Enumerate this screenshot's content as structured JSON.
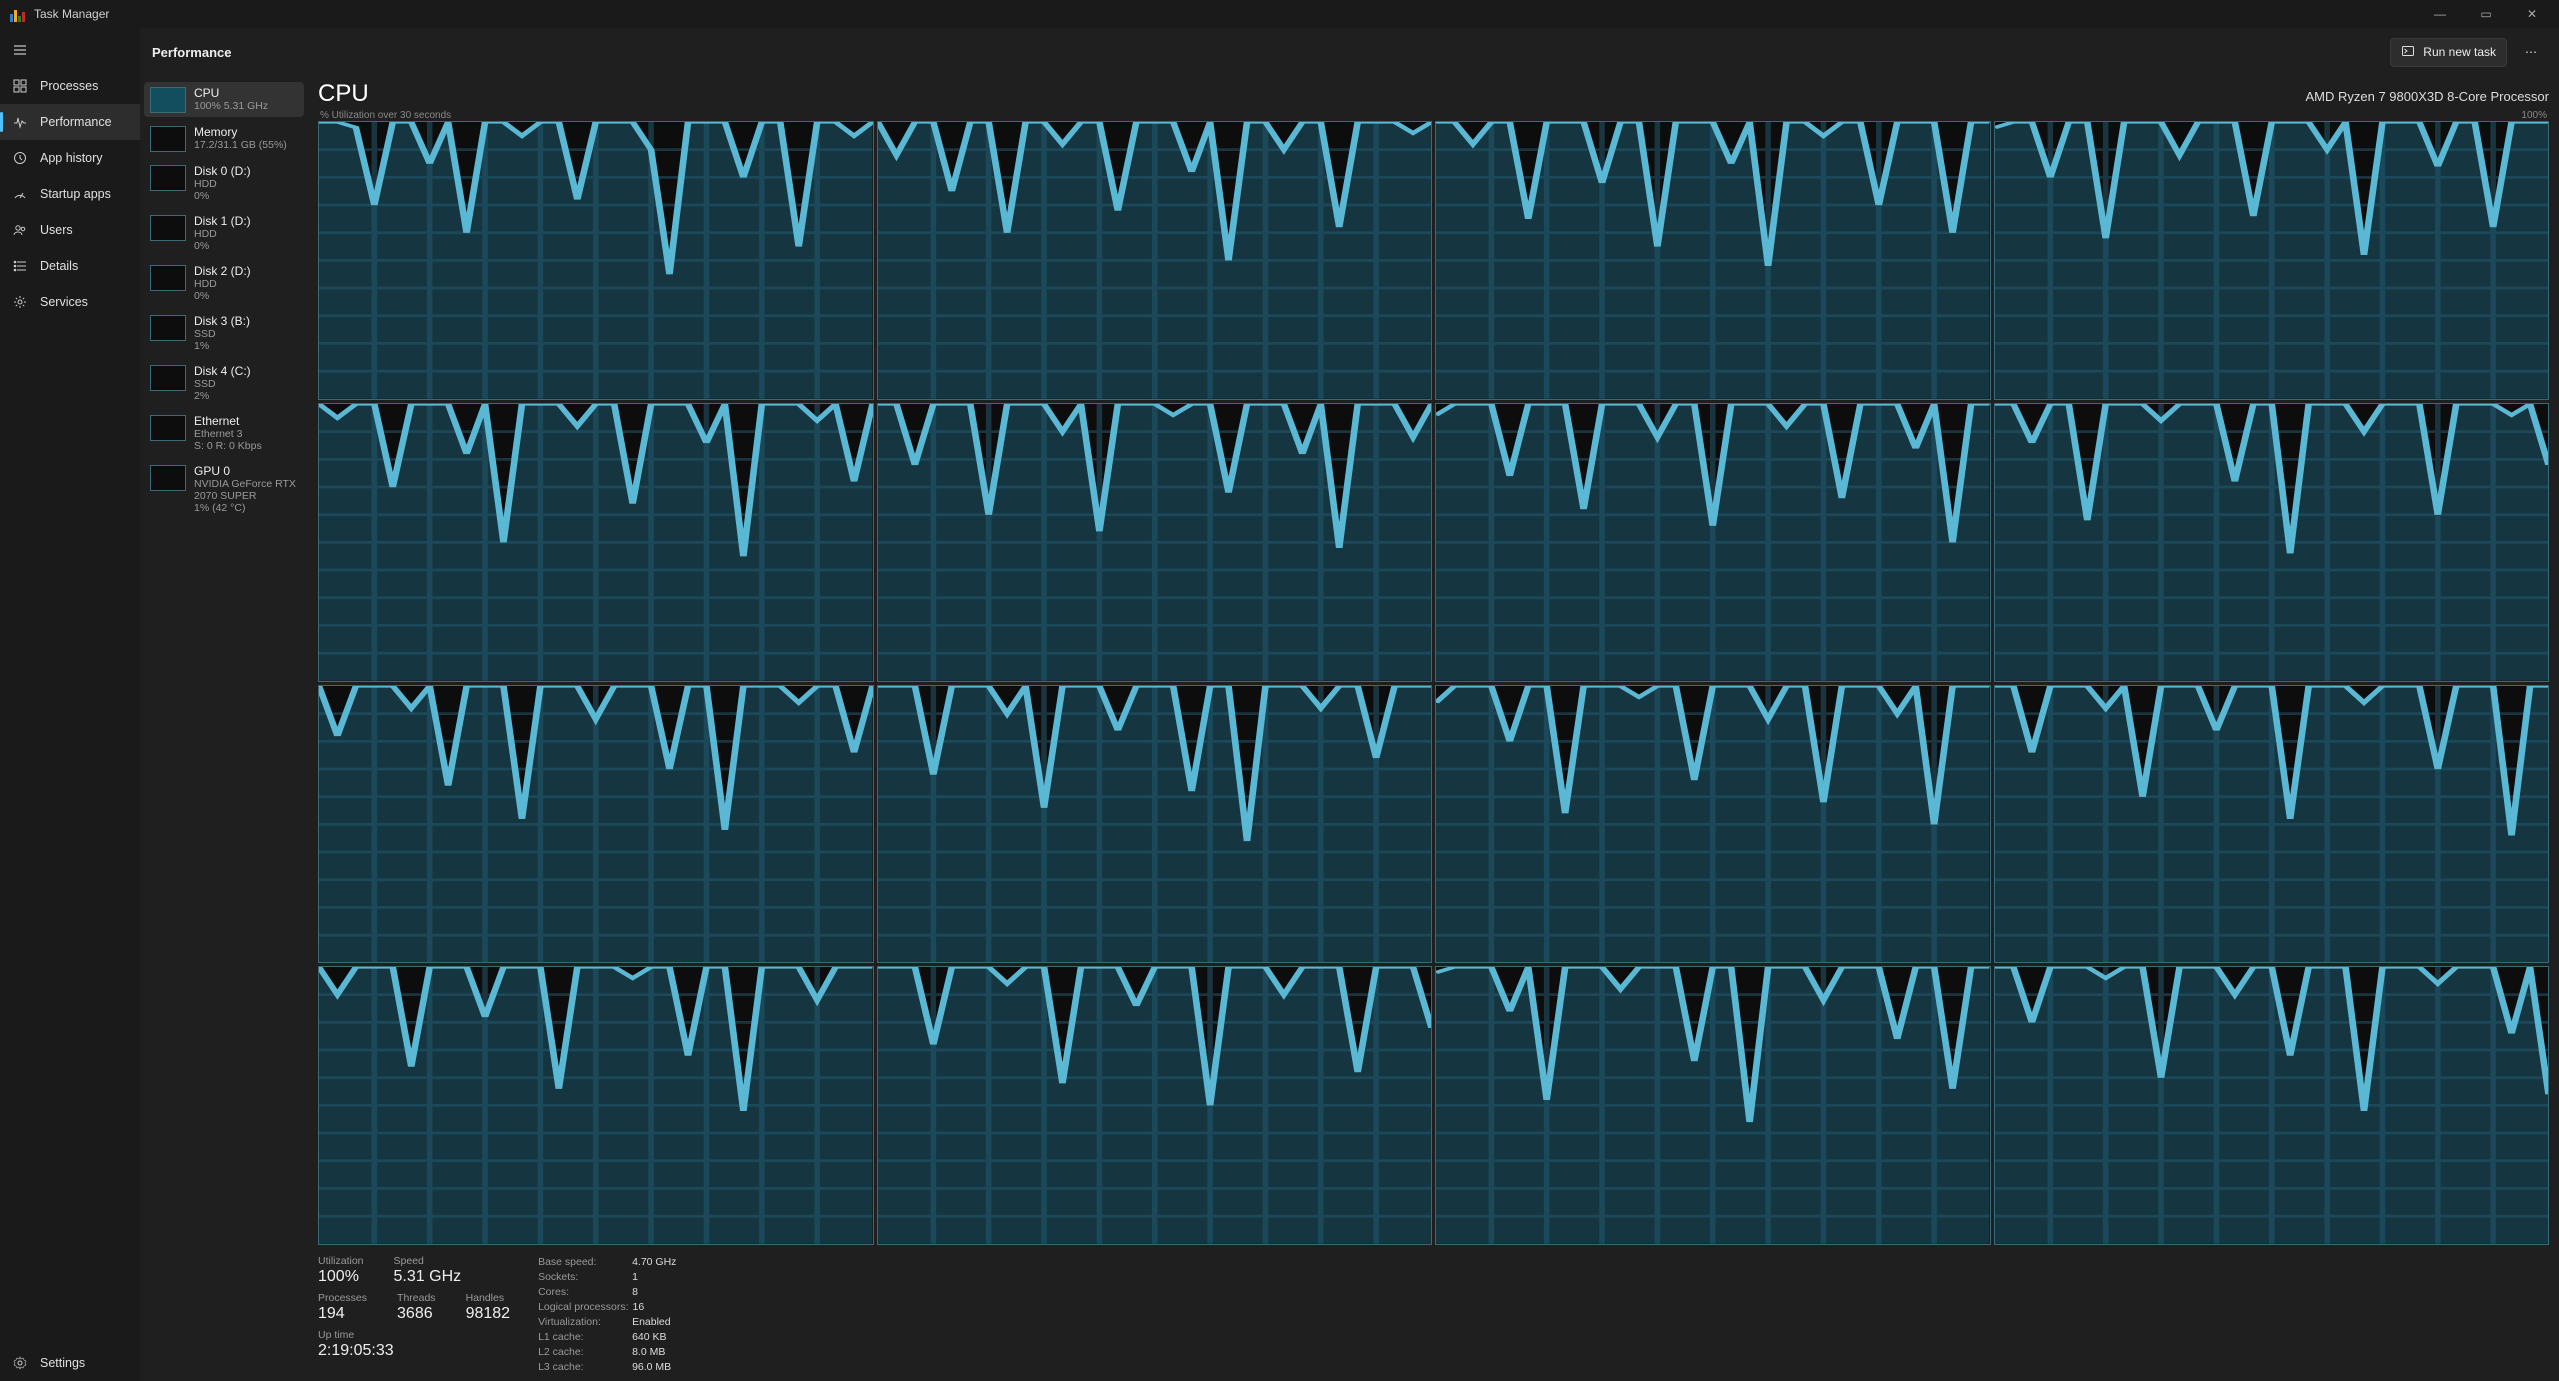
{
  "app_title": "Task Manager",
  "window_controls": {
    "min": "—",
    "max": "▭",
    "close": "✕"
  },
  "nav": {
    "items": [
      {
        "id": "processes",
        "label": "Processes"
      },
      {
        "id": "performance",
        "label": "Performance",
        "selected": true
      },
      {
        "id": "apphistory",
        "label": "App history"
      },
      {
        "id": "startup",
        "label": "Startup apps"
      },
      {
        "id": "users",
        "label": "Users"
      },
      {
        "id": "details",
        "label": "Details"
      },
      {
        "id": "services",
        "label": "Services"
      }
    ],
    "settings_label": "Settings"
  },
  "toolbar": {
    "heading": "Performance",
    "run_new_task": "Run new task"
  },
  "resources": [
    {
      "id": "cpu",
      "title": "CPU",
      "sub": "100%  5.31 GHz",
      "selected": true
    },
    {
      "id": "memory",
      "title": "Memory",
      "sub": "17.2/31.1 GB (55%)"
    },
    {
      "id": "disk0",
      "title": "Disk 0 (D:)",
      "sub": "HDD",
      "sub2": "0%"
    },
    {
      "id": "disk1",
      "title": "Disk 1 (D:)",
      "sub": "HDD",
      "sub2": "0%"
    },
    {
      "id": "disk2",
      "title": "Disk 2 (D:)",
      "sub": "HDD",
      "sub2": "0%"
    },
    {
      "id": "disk3",
      "title": "Disk 3 (B:)",
      "sub": "SSD",
      "sub2": "1%"
    },
    {
      "id": "disk4",
      "title": "Disk 4 (C:)",
      "sub": "SSD",
      "sub2": "2%"
    },
    {
      "id": "ethernet",
      "title": "Ethernet",
      "sub": "Ethernet 3",
      "sub2": "S: 0  R: 0 Kbps"
    },
    {
      "id": "gpu0",
      "title": "GPU 0",
      "sub": "NVIDIA GeForce RTX 2070 SUPER",
      "sub2": "1% (42 °C)"
    }
  ],
  "detail": {
    "title": "CPU",
    "device_name": "AMD Ryzen 7 9800X3D 8-Core Processor",
    "axis_left": "% Utilization over 30 seconds",
    "axis_right": "100%",
    "stats_primary": {
      "utilization_label": "Utilization",
      "utilization": "100%",
      "speed_label": "Speed",
      "speed": "5.31 GHz",
      "processes_label": "Processes",
      "processes": "194",
      "threads_label": "Threads",
      "threads": "3686",
      "handles_label": "Handles",
      "handles": "98182",
      "uptime_label": "Up time",
      "uptime": "2:19:05:33"
    },
    "stats_kv": [
      {
        "k": "Base speed:",
        "v": "4.70 GHz"
      },
      {
        "k": "Sockets:",
        "v": "1"
      },
      {
        "k": "Cores:",
        "v": "8"
      },
      {
        "k": "Logical processors:",
        "v": "16"
      },
      {
        "k": "Virtualization:",
        "v": "Enabled"
      },
      {
        "k": "L1 cache:",
        "v": "640 KB"
      },
      {
        "k": "L2 cache:",
        "v": "8.0 MB"
      },
      {
        "k": "L3 cache:",
        "v": "96.0 MB"
      }
    ]
  },
  "chart_data": {
    "type": "line",
    "description": "16 per-logical-processor utilization sparklines, 0-100% over 30 seconds",
    "x_seconds": [
      30,
      29,
      28,
      27,
      26,
      25,
      24,
      23,
      22,
      21,
      20,
      19,
      18,
      17,
      16,
      15,
      14,
      13,
      12,
      11,
      10,
      9,
      8,
      7,
      6,
      5,
      4,
      3,
      2,
      1,
      0
    ],
    "ylim": [
      0,
      100
    ],
    "cores": [
      [
        100,
        100,
        98,
        70,
        100,
        100,
        85,
        100,
        60,
        100,
        100,
        95,
        100,
        100,
        72,
        100,
        100,
        100,
        90,
        45,
        100,
        100,
        100,
        80,
        100,
        100,
        55,
        100,
        100,
        95,
        100
      ],
      [
        100,
        88,
        100,
        100,
        75,
        100,
        100,
        60,
        100,
        100,
        92,
        100,
        100,
        68,
        100,
        100,
        100,
        82,
        100,
        50,
        100,
        100,
        90,
        100,
        100,
        62,
        100,
        100,
        100,
        96,
        100
      ],
      [
        100,
        100,
        92,
        100,
        100,
        65,
        100,
        100,
        100,
        78,
        100,
        100,
        55,
        100,
        100,
        100,
        85,
        100,
        48,
        100,
        100,
        95,
        100,
        100,
        70,
        100,
        100,
        100,
        60,
        100,
        100
      ],
      [
        98,
        100,
        100,
        80,
        100,
        100,
        58,
        100,
        100,
        100,
        88,
        100,
        100,
        100,
        66,
        100,
        100,
        100,
        90,
        100,
        52,
        100,
        100,
        100,
        84,
        100,
        100,
        62,
        100,
        100,
        100
      ],
      [
        100,
        95,
        100,
        100,
        70,
        100,
        100,
        100,
        82,
        100,
        50,
        100,
        100,
        100,
        92,
        100,
        100,
        64,
        100,
        100,
        100,
        86,
        100,
        45,
        100,
        100,
        100,
        94,
        100,
        72,
        100
      ],
      [
        100,
        100,
        78,
        100,
        100,
        100,
        60,
        100,
        100,
        100,
        90,
        100,
        54,
        100,
        100,
        100,
        96,
        100,
        100,
        68,
        100,
        100,
        100,
        82,
        100,
        48,
        100,
        100,
        100,
        88,
        100
      ],
      [
        96,
        100,
        100,
        100,
        74,
        100,
        100,
        100,
        62,
        100,
        100,
        100,
        88,
        100,
        100,
        56,
        100,
        100,
        100,
        92,
        100,
        100,
        66,
        100,
        100,
        100,
        84,
        100,
        50,
        100,
        100
      ],
      [
        100,
        100,
        86,
        100,
        100,
        58,
        100,
        100,
        100,
        94,
        100,
        100,
        100,
        72,
        100,
        100,
        46,
        100,
        100,
        100,
        90,
        100,
        100,
        100,
        60,
        100,
        100,
        100,
        96,
        100,
        78
      ],
      [
        100,
        82,
        100,
        100,
        100,
        92,
        100,
        64,
        100,
        100,
        100,
        52,
        100,
        100,
        100,
        88,
        100,
        100,
        100,
        70,
        100,
        100,
        48,
        100,
        100,
        100,
        94,
        100,
        100,
        76,
        100
      ],
      [
        100,
        100,
        100,
        68,
        100,
        100,
        100,
        90,
        100,
        56,
        100,
        100,
        100,
        84,
        100,
        100,
        100,
        62,
        100,
        100,
        44,
        100,
        100,
        100,
        92,
        100,
        100,
        74,
        100,
        100,
        100
      ],
      [
        94,
        100,
        100,
        100,
        80,
        100,
        100,
        54,
        100,
        100,
        100,
        96,
        100,
        100,
        66,
        100,
        100,
        100,
        88,
        100,
        100,
        58,
        100,
        100,
        100,
        90,
        100,
        50,
        100,
        100,
        100
      ],
      [
        100,
        100,
        76,
        100,
        100,
        100,
        92,
        100,
        60,
        100,
        100,
        100,
        84,
        100,
        100,
        100,
        52,
        100,
        100,
        100,
        94,
        100,
        100,
        100,
        70,
        100,
        100,
        100,
        46,
        100,
        100
      ],
      [
        100,
        90,
        100,
        100,
        100,
        64,
        100,
        100,
        100,
        82,
        100,
        100,
        100,
        56,
        100,
        100,
        100,
        96,
        100,
        100,
        68,
        100,
        100,
        48,
        100,
        100,
        100,
        88,
        100,
        100,
        100
      ],
      [
        100,
        100,
        100,
        72,
        100,
        100,
        100,
        94,
        100,
        100,
        58,
        100,
        100,
        100,
        86,
        100,
        100,
        100,
        50,
        100,
        100,
        100,
        90,
        100,
        100,
        100,
        62,
        100,
        100,
        100,
        78
      ],
      [
        98,
        100,
        100,
        100,
        84,
        100,
        52,
        100,
        100,
        100,
        92,
        100,
        100,
        100,
        66,
        100,
        100,
        44,
        100,
        100,
        100,
        88,
        100,
        100,
        100,
        74,
        100,
        100,
        56,
        100,
        100
      ],
      [
        100,
        100,
        80,
        100,
        100,
        100,
        96,
        100,
        100,
        60,
        100,
        100,
        100,
        90,
        100,
        100,
        68,
        100,
        100,
        100,
        48,
        100,
        100,
        100,
        94,
        100,
        100,
        100,
        76,
        100,
        54
      ]
    ]
  }
}
